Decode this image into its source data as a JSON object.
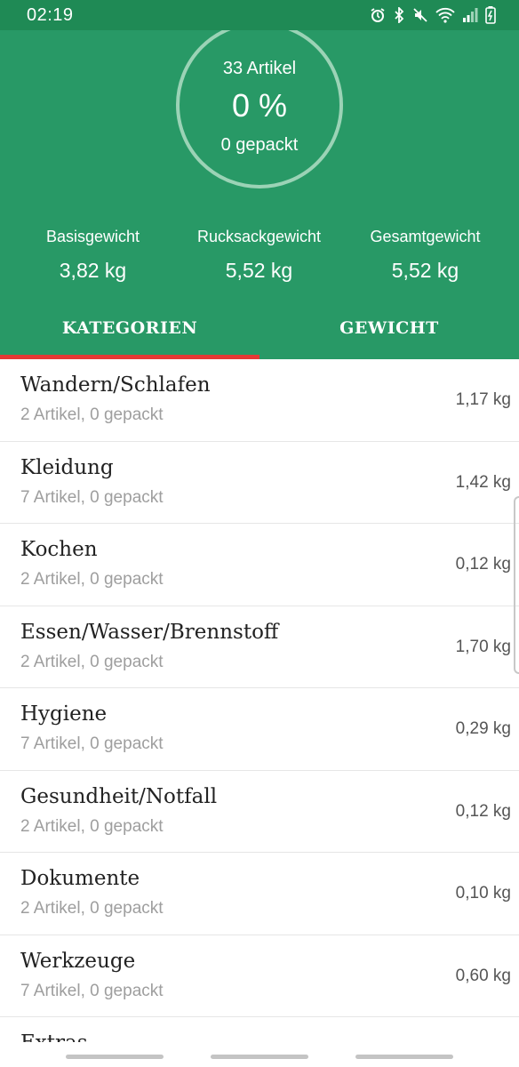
{
  "status": {
    "time": "02:19"
  },
  "summary": {
    "items_count": "33 Artikel",
    "percent": "0 %",
    "packed": "0 gepackt",
    "progress_fraction": 0
  },
  "weights": [
    {
      "label": "Basisgewicht",
      "value": "3,82 kg"
    },
    {
      "label": "Rucksackgewicht",
      "value": "5,52 kg"
    },
    {
      "label": "Gesamtgewicht",
      "value": "5,52 kg"
    }
  ],
  "tabs": [
    {
      "label": "KATEGORIEN",
      "active": true
    },
    {
      "label": "GEWICHT",
      "active": false
    }
  ],
  "categories": [
    {
      "title": "Wandern/Schlafen",
      "sub": "2 Artikel, 0 gepackt",
      "weight": "1,17 kg"
    },
    {
      "title": "Kleidung",
      "sub": "7 Artikel, 0 gepackt",
      "weight": "1,42 kg"
    },
    {
      "title": "Kochen",
      "sub": "2 Artikel, 0 gepackt",
      "weight": "0,12 kg"
    },
    {
      "title": "Essen/Wasser/Brennstoff",
      "sub": "2 Artikel, 0 gepackt",
      "weight": "1,70 kg"
    },
    {
      "title": "Hygiene",
      "sub": "7 Artikel, 0 gepackt",
      "weight": "0,29 kg"
    },
    {
      "title": "Gesundheit/Notfall",
      "sub": "2 Artikel, 0 gepackt",
      "weight": "0,12 kg"
    },
    {
      "title": "Dokumente",
      "sub": "2 Artikel, 0 gepackt",
      "weight": "0,10 kg"
    },
    {
      "title": "Werkzeuge",
      "sub": "7 Artikel, 0 gepackt",
      "weight": "0,60 kg"
    },
    {
      "title": "Extras",
      "sub": "",
      "weight": ""
    }
  ],
  "colors": {
    "header_green": "#289966",
    "status_green": "#1f8a55",
    "tab_indicator": "#e53935"
  },
  "icons": [
    "alarm-icon",
    "bluetooth-icon",
    "mute-icon",
    "wifi-icon",
    "signal-icon",
    "battery-icon"
  ]
}
